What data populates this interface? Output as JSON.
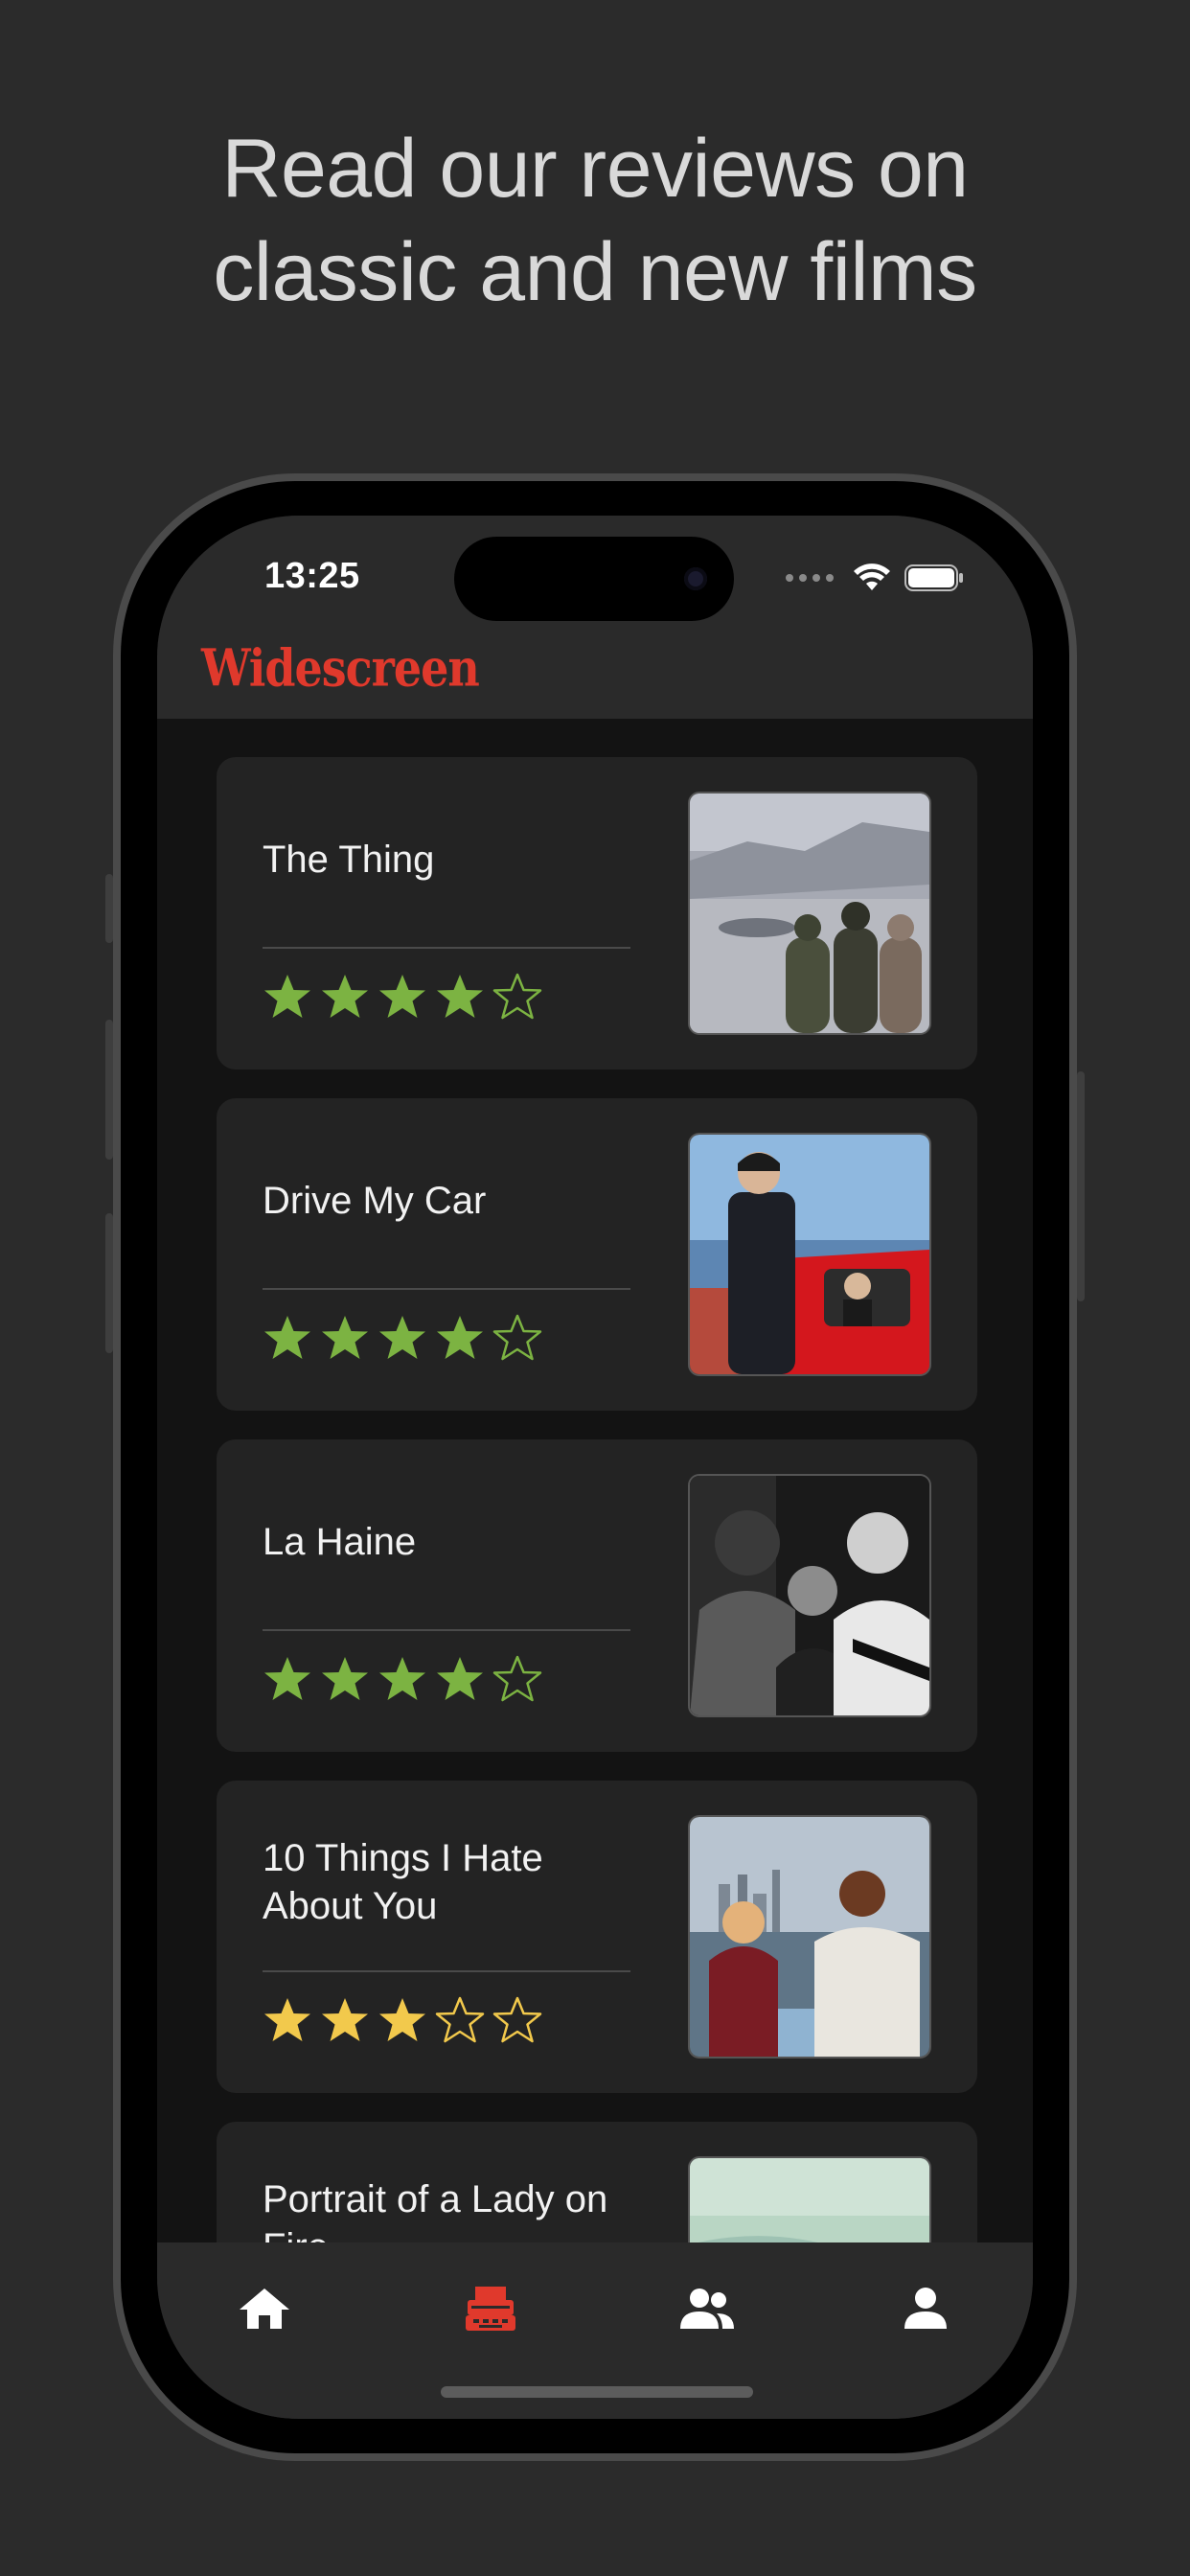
{
  "headline": {
    "line1": "Read our reviews on",
    "line2": "classic and new films"
  },
  "status_bar": {
    "time": "13:25"
  },
  "app": {
    "logo_text": "Widescreen",
    "accent_color": "#e0392c"
  },
  "reviews": [
    {
      "title": "The Thing",
      "rating": 4,
      "max_rating": 5,
      "star_color": "#7cb342"
    },
    {
      "title": "Drive My Car",
      "rating": 4,
      "max_rating": 5,
      "star_color": "#7cb342"
    },
    {
      "title": "La Haine",
      "rating": 4,
      "max_rating": 5,
      "star_color": "#7cb342"
    },
    {
      "title": "10 Things I Hate About You",
      "rating": 3,
      "max_rating": 5,
      "star_color": "#f2c94c"
    },
    {
      "title": "Portrait of a Lady on Fire",
      "rating": null,
      "max_rating": 5,
      "star_color": ""
    }
  ],
  "tab_bar": {
    "tabs": [
      {
        "name": "home",
        "icon": "home-icon",
        "active": false
      },
      {
        "name": "reviews",
        "icon": "typewriter-icon",
        "active": true
      },
      {
        "name": "community",
        "icon": "people-icon",
        "active": false
      },
      {
        "name": "profile",
        "icon": "person-icon",
        "active": false
      }
    ],
    "active_color": "#e0392c",
    "inactive_color": "#ffffff"
  }
}
